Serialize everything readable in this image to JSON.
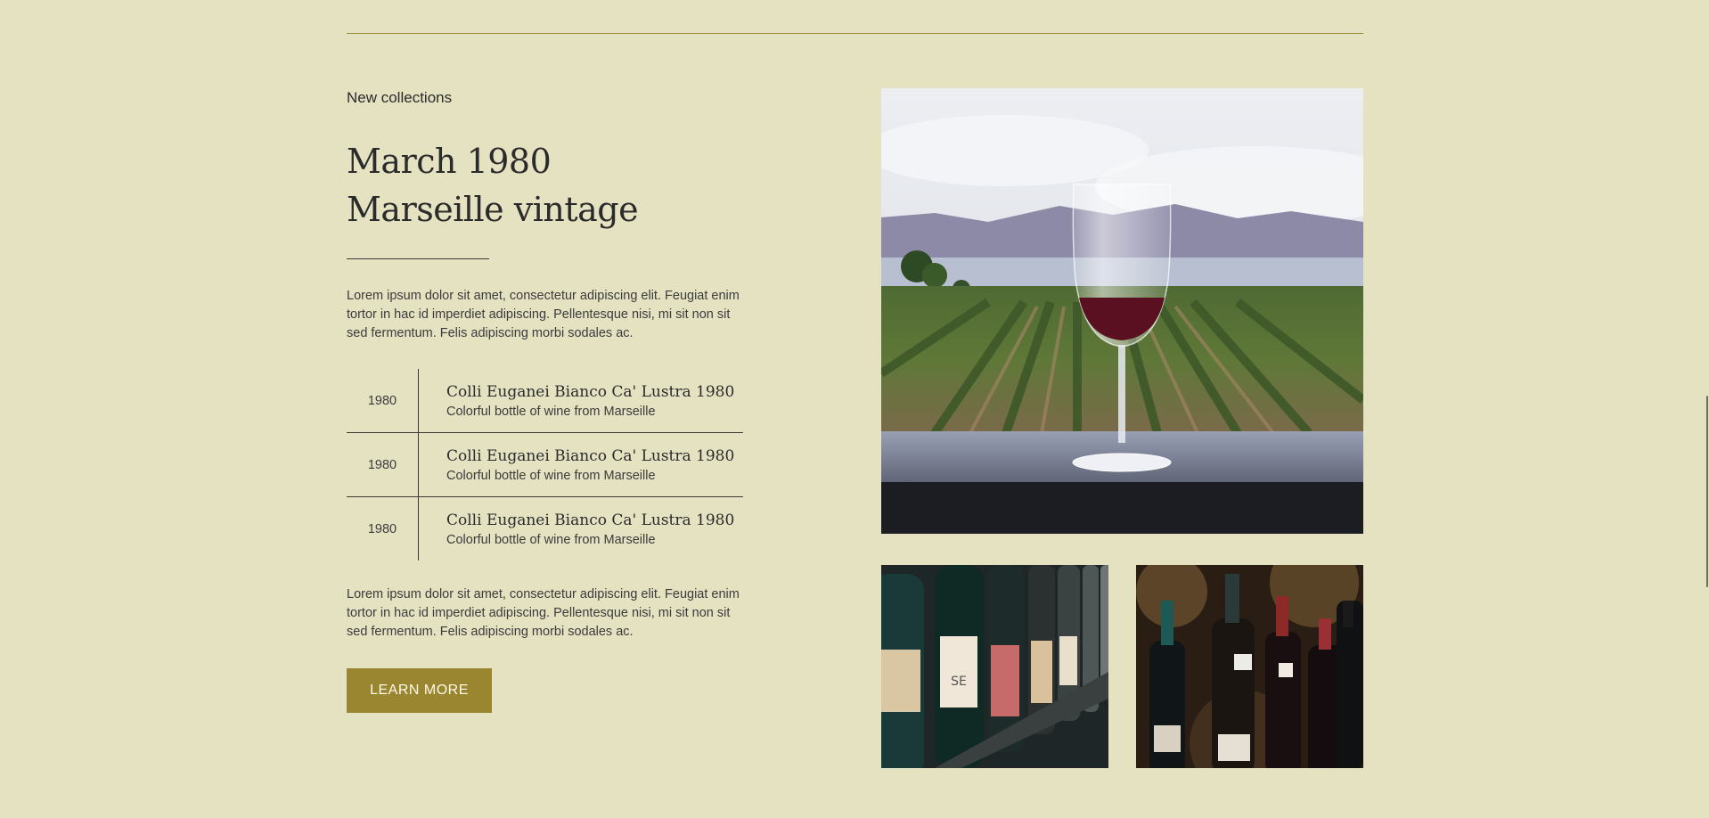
{
  "section": {
    "eyebrow": "New collections",
    "title_line1": "March 1980",
    "title_line2": "Marseille vintage",
    "paragraph1": "Lorem ipsum dolor sit amet, consectetur adipiscing elit. Feugiat enim tortor in hac id imperdiet adipiscing. Pellentesque nisi, mi sit non sit sed fermentum. Felis adipiscing morbi sodales ac.",
    "paragraph2": "Lorem ipsum dolor sit amet, consectetur adipiscing elit. Feugiat enim tortor in hac id imperdiet adipiscing. Pellentesque nisi, mi sit non sit sed fermentum. Felis adipiscing morbi sodales ac.",
    "button_label": "LEARN MORE"
  },
  "collection": [
    {
      "year": "1980",
      "name": "Colli Euganei Bianco Ca' Lustra 1980",
      "description": "Colorful bottle of wine from Marseille"
    },
    {
      "year": "1980",
      "name": "Colli Euganei Bianco Ca' Lustra 1980",
      "description": "Colorful bottle of wine from Marseille"
    },
    {
      "year": "1980",
      "name": "Colli Euganei Bianco Ca' Lustra 1980",
      "description": "Colorful bottle of wine from Marseille"
    }
  ],
  "images": {
    "main": "wine-glass-vineyard-photo",
    "left": "wine-bottles-shelf-photo",
    "right": "wine-bottles-store-photo"
  },
  "colors": {
    "background": "#e5e2c2",
    "accent": "#9a8530",
    "rule": "#9a8a3a",
    "text": "#2b2b2b"
  }
}
